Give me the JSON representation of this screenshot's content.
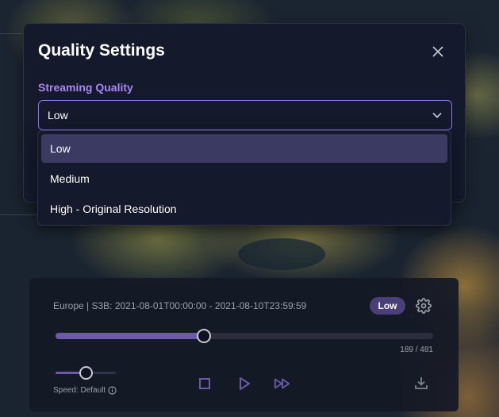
{
  "modal": {
    "title": "Quality Settings",
    "field_label": "Streaming Quality",
    "selected_value": "Low",
    "options": [
      "Low",
      "Medium",
      "High - Original Resolution"
    ],
    "selected_index": 0
  },
  "player": {
    "info": "Europe | S3B: 2021-08-01T00:00:00 - 2021-08-10T23:59:59",
    "quality_badge": "Low",
    "frame_counter": "189 / 481",
    "progress_fraction": 0.39,
    "speed_label": "Speed: Default",
    "speed_fraction": 0.5
  },
  "colors": {
    "accent": "#a985f5",
    "badge": "#4a3f7a",
    "track_fill": "#6b5aa8"
  },
  "icons": [
    "close-icon",
    "chevron-down-icon",
    "gear-icon",
    "info-icon",
    "stop-icon",
    "play-icon",
    "fast-forward-icon",
    "download-icon"
  ]
}
